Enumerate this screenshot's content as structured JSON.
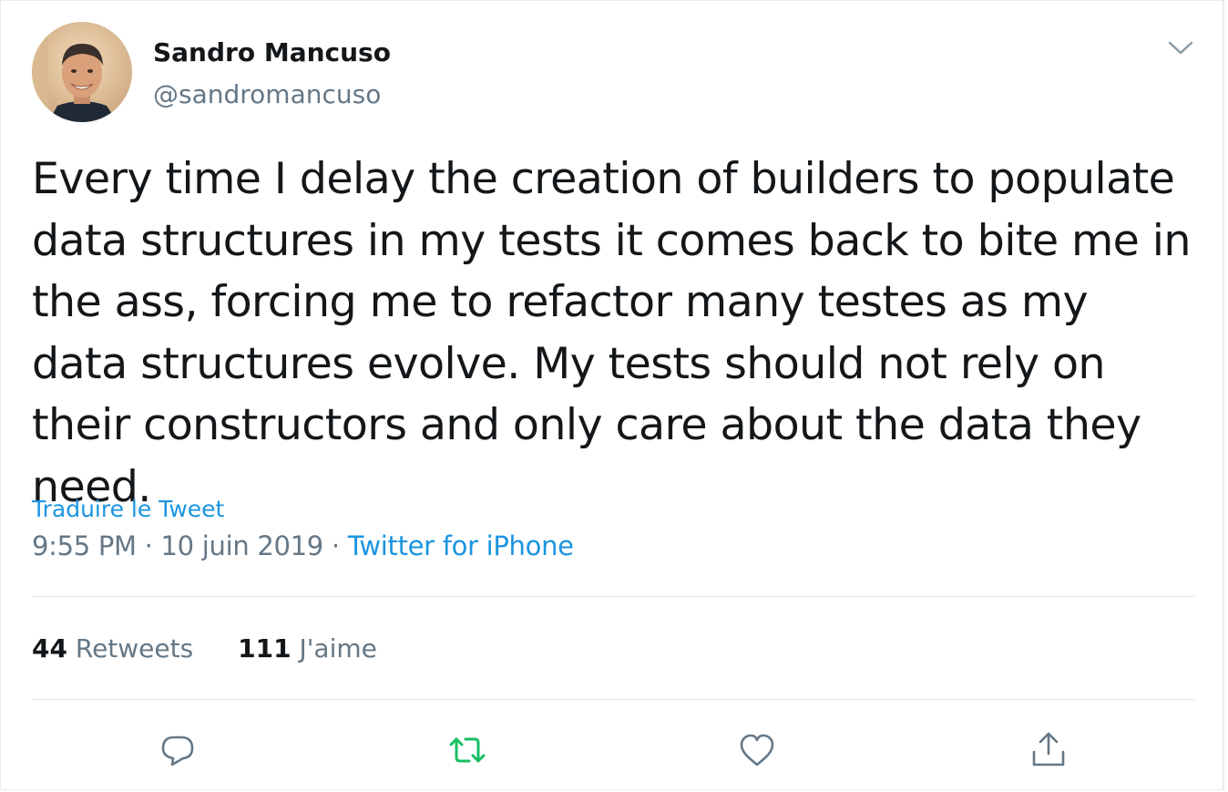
{
  "author": {
    "display_name": "Sandro Mancuso",
    "handle": "@sandromancuso"
  },
  "tweet": {
    "text": "Every time I delay the creation of builders to populate data structures in my tests it comes back to bite me in the ass, forcing me to refactor many testes as my data structures evolve. My tests should not rely on their constructors and only care about the data they need.",
    "translate_label": "Traduire le Tweet",
    "time": "9:55 PM",
    "separator": "·",
    "date": "10 juin 2019",
    "source": "Twitter for iPhone"
  },
  "stats": {
    "retweets_count": "44",
    "retweets_label": "Retweets",
    "likes_count": "111",
    "likes_label": "J'aime"
  },
  "icons": {
    "more": "chevron-down-icon",
    "reply": "reply-icon",
    "retweet": "retweet-icon",
    "like": "heart-icon",
    "share": "share-icon"
  },
  "colors": {
    "text": "#14171a",
    "secondary": "#657786",
    "link": "#1b95e0",
    "retweet_active": "#17bf63",
    "divider": "#e1e8ed"
  }
}
